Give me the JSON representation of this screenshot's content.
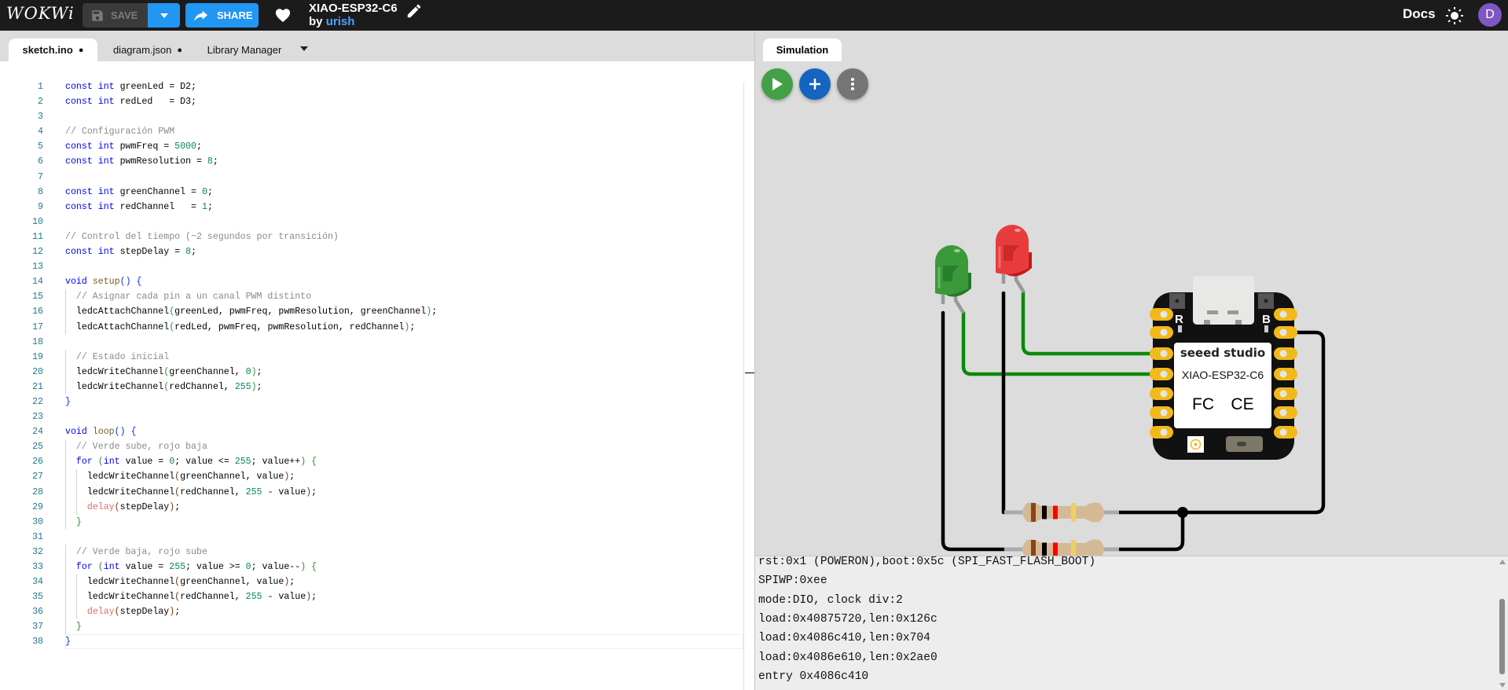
{
  "header": {
    "logo": "WOKWi",
    "save_label": "SAVE",
    "share_label": "SHARE",
    "project_title": "XIAO-ESP32-C6",
    "by_label": "by",
    "author": "urish",
    "docs_label": "Docs",
    "avatar_initial": "D",
    "accent": "#2196f3",
    "avatar_color": "#7e57c2"
  },
  "editor_tabs": [
    {
      "label": "sketch.ino",
      "modified": "●"
    },
    {
      "label": "diagram.json",
      "modified": "●"
    },
    {
      "label": "Library Manager"
    }
  ],
  "editor": {
    "lines": [
      "const int greenLed = D2;",
      "const int redLed   = D3;",
      "",
      "// Configuración PWM",
      "const int pwmFreq = 5000;",
      "const int pwmResolution = 8;",
      "",
      "const int greenChannel = 0;",
      "const int redChannel   = 1;",
      "",
      "// Control del tiempo (~2 segundos por transición)",
      "const int stepDelay = 8;",
      "",
      "void setup() {",
      "  // Asignar cada pin a un canal PWM distinto",
      "  ledcAttachChannel(greenLed, pwmFreq, pwmResolution, greenChannel);",
      "  ledcAttachChannel(redLed, pwmFreq, pwmResolution, redChannel);",
      "",
      "  // Estado inicial",
      "  ledcWriteChannel(greenChannel, 0);",
      "  ledcWriteChannel(redChannel, 255);",
      "}",
      "",
      "void loop() {",
      "  // Verde sube, rojo baja",
      "  for (int value = 0; value <= 255; value++) {",
      "    ledcWriteChannel(greenChannel, value);",
      "    ledcWriteChannel(redChannel, 255 - value);",
      "    delay(stepDelay);",
      "  }",
      "",
      "  // Verde baja, rojo sube",
      "  for (int value = 255; value >= 0; value--) {",
      "    ledcWriteChannel(greenChannel, value);",
      "    ledcWriteChannel(redChannel, 255 - value);",
      "    delay(stepDelay);",
      "  }",
      "}"
    ],
    "current_line": 38
  },
  "simulation": {
    "tab_label": "Simulation",
    "board": {
      "brand": "seeed studio",
      "model": "XIAO-ESP32-C6",
      "pin_r": "R",
      "pin_b": "B",
      "fc": "FC",
      "ce": "CE"
    },
    "led_colors": {
      "green": "#3a9a3a",
      "red": "#e83c3c"
    },
    "resistor_bands": [
      "#8b4513",
      "#000000",
      "#ff0000",
      "#f0d060"
    ]
  },
  "serial": {
    "lines": [
      "rst:0x1 (POWERON),boot:0x5c (SPI_FAST_FLASH_BOOT)",
      "SPIWP:0xee",
      "mode:DIO, clock div:2",
      "load:0x40875720,len:0x126c",
      "load:0x4086c410,len:0x704",
      "load:0x4086e610,len:0x2ae0",
      "entry 0x4086c410"
    ]
  }
}
